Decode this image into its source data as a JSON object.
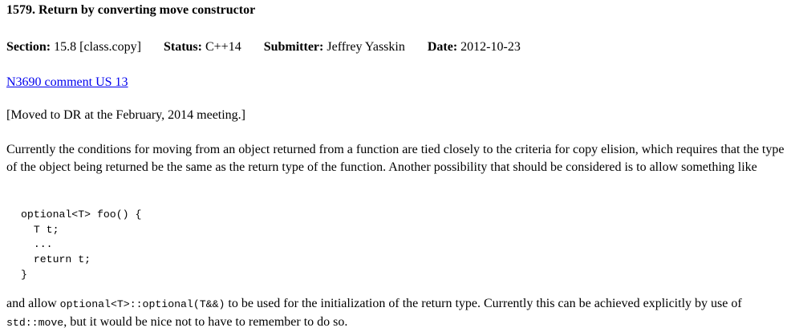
{
  "issue": {
    "title": "1579. Return by converting move constructor",
    "meta": {
      "section_label": "Section:",
      "section_value": "15.8  [class.copy]",
      "status_label": "Status:",
      "status_value": "C++14",
      "submitter_label": "Submitter:",
      "submitter_value": "Jeffrey Yasskin",
      "date_label": "Date:",
      "date_value": "2012-10-23"
    },
    "link_text": "N3690 comment US 13",
    "note": "[Moved to DR at the February, 2014 meeting.]",
    "paragraph1": "Currently the conditions for moving from an object returned from a function are tied closely to the criteria for copy elision, which requires that the type of the object being returned be the same as the return type of the function. Another possibility that should be considered is to allow something like",
    "code_lines": [
      "optional<T> foo() {",
      "  T t;",
      "  ...",
      "  return t;",
      "}"
    ],
    "paragraph2": {
      "part1": "and allow ",
      "code1": "optional<T>::optional(T&&)",
      "part2": " to be used for the initialization of the return type. Currently this can be achieved explicitly by use of ",
      "code2": "std::move",
      "part3": ", but it would be nice not to have to remember to do so."
    }
  }
}
